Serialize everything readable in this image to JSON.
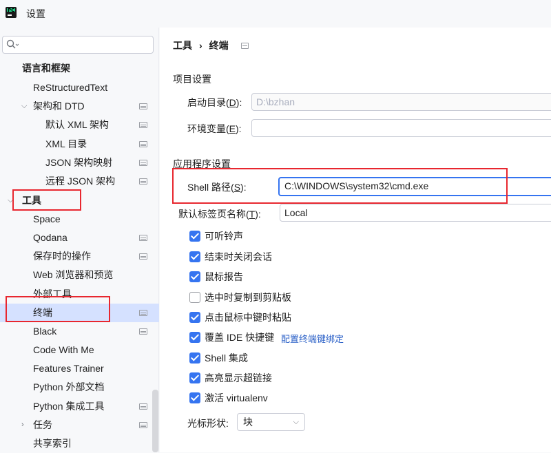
{
  "window": {
    "title": "设置"
  },
  "search": {
    "placeholder": ""
  },
  "sidebar": {
    "items": [
      {
        "label": "语言和框架",
        "bold": true
      },
      {
        "label": "ReStructuredText"
      },
      {
        "label": "架构和 DTD",
        "expanded": true
      },
      {
        "label": "默认 XML 架构"
      },
      {
        "label": "XML 目录"
      },
      {
        "label": "JSON 架构映射"
      },
      {
        "label": "远程 JSON 架构"
      },
      {
        "label": "工具",
        "bold": true,
        "expanded": true
      },
      {
        "label": "Space"
      },
      {
        "label": "Qodana"
      },
      {
        "label": "保存时的操作"
      },
      {
        "label": "Web 浏览器和预览"
      },
      {
        "label": "外部工具"
      },
      {
        "label": "终端",
        "selected": true
      },
      {
        "label": "Black"
      },
      {
        "label": "Code With Me"
      },
      {
        "label": "Features Trainer"
      },
      {
        "label": "Python 外部文档"
      },
      {
        "label": "Python 集成工具"
      },
      {
        "label": "任务",
        "expanded": false
      },
      {
        "label": "共享索引"
      }
    ]
  },
  "breadcrumb": {
    "parent": "工具",
    "separator": "›",
    "current": "终端"
  },
  "project_settings": {
    "title": "项目设置",
    "start_dir": {
      "label_pre": "启动目录(",
      "mnemonic": "D",
      "label_post": "):",
      "value": "D:\\bzhan"
    },
    "env_vars": {
      "label_pre": "环境变量(",
      "mnemonic": "E",
      "label_post": "):",
      "value": ""
    }
  },
  "app_settings": {
    "title": "应用程序设置",
    "shell_path": {
      "label_pre": "Shell 路径(",
      "mnemonic": "S",
      "label_post": "):",
      "value": "C:\\WINDOWS\\system32\\cmd.exe"
    },
    "tab_name": {
      "label_pre": "默认标签页名称(",
      "mnemonic": "T",
      "label_post": "):",
      "value": "Local"
    },
    "checkboxes": [
      {
        "label": "可听铃声",
        "checked": true
      },
      {
        "label": "结束时关闭会话",
        "checked": true
      },
      {
        "label": "鼠标报告",
        "checked": true
      },
      {
        "label": "选中时复制到剪贴板",
        "checked": false
      },
      {
        "label": "点击鼠标中键时粘贴",
        "checked": true
      },
      {
        "label": "覆盖 IDE 快捷键",
        "checked": true
      },
      {
        "label": "Shell 集成",
        "checked": true
      },
      {
        "label": "高亮显示超链接",
        "checked": true
      },
      {
        "label": "激活 virtualenv",
        "checked": true
      }
    ],
    "keymap_link": "配置终端键绑定",
    "cursor_shape": {
      "label": "光标形状:",
      "value": "块",
      "arrow": "⌵"
    }
  },
  "colors": {
    "accent": "#3574f0",
    "highlight": "#e8272f",
    "selected_row": "#d5e1ff",
    "link": "#2d62c8"
  }
}
